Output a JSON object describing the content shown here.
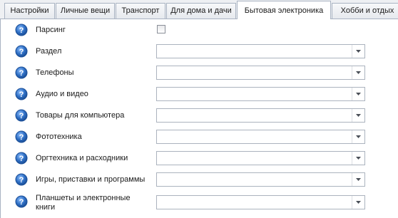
{
  "tabs": [
    {
      "label": "Настройки",
      "active": false
    },
    {
      "label": "Личные вещи",
      "active": false
    },
    {
      "label": "Транспорт",
      "active": false
    },
    {
      "label": "Для дома и дачи",
      "active": false
    },
    {
      "label": "Бытовая электроника",
      "active": true
    },
    {
      "label": "Хобби и отдых",
      "active": false
    }
  ],
  "fields": {
    "parsing": {
      "label": "Парсинг",
      "icon": "help-icon",
      "checked": false
    },
    "section": {
      "label": "Раздел",
      "icon": "help-icon",
      "value": ""
    },
    "phones": {
      "label": "Телефоны",
      "icon": "help-icon",
      "value": ""
    },
    "audio_video": {
      "label": "Аудио и видео",
      "icon": "help-icon",
      "value": ""
    },
    "computer_goods": {
      "label": "Товары для компьютера",
      "icon": "help-icon",
      "value": ""
    },
    "photo": {
      "label": "Фототехника",
      "icon": "help-icon",
      "value": ""
    },
    "office": {
      "label": "Оргтехника и расходники",
      "icon": "help-icon",
      "value": ""
    },
    "games": {
      "label": "Игры, приставки и программы",
      "icon": "help-icon",
      "value": ""
    },
    "tablets": {
      "label": "Планшеты и электронные книги",
      "icon": "help-icon",
      "value": ""
    }
  },
  "colors": {
    "help_icon_fill": "#2f6fc4",
    "tab_border": "#a9b3c2",
    "combo_border": "#abb3be"
  }
}
